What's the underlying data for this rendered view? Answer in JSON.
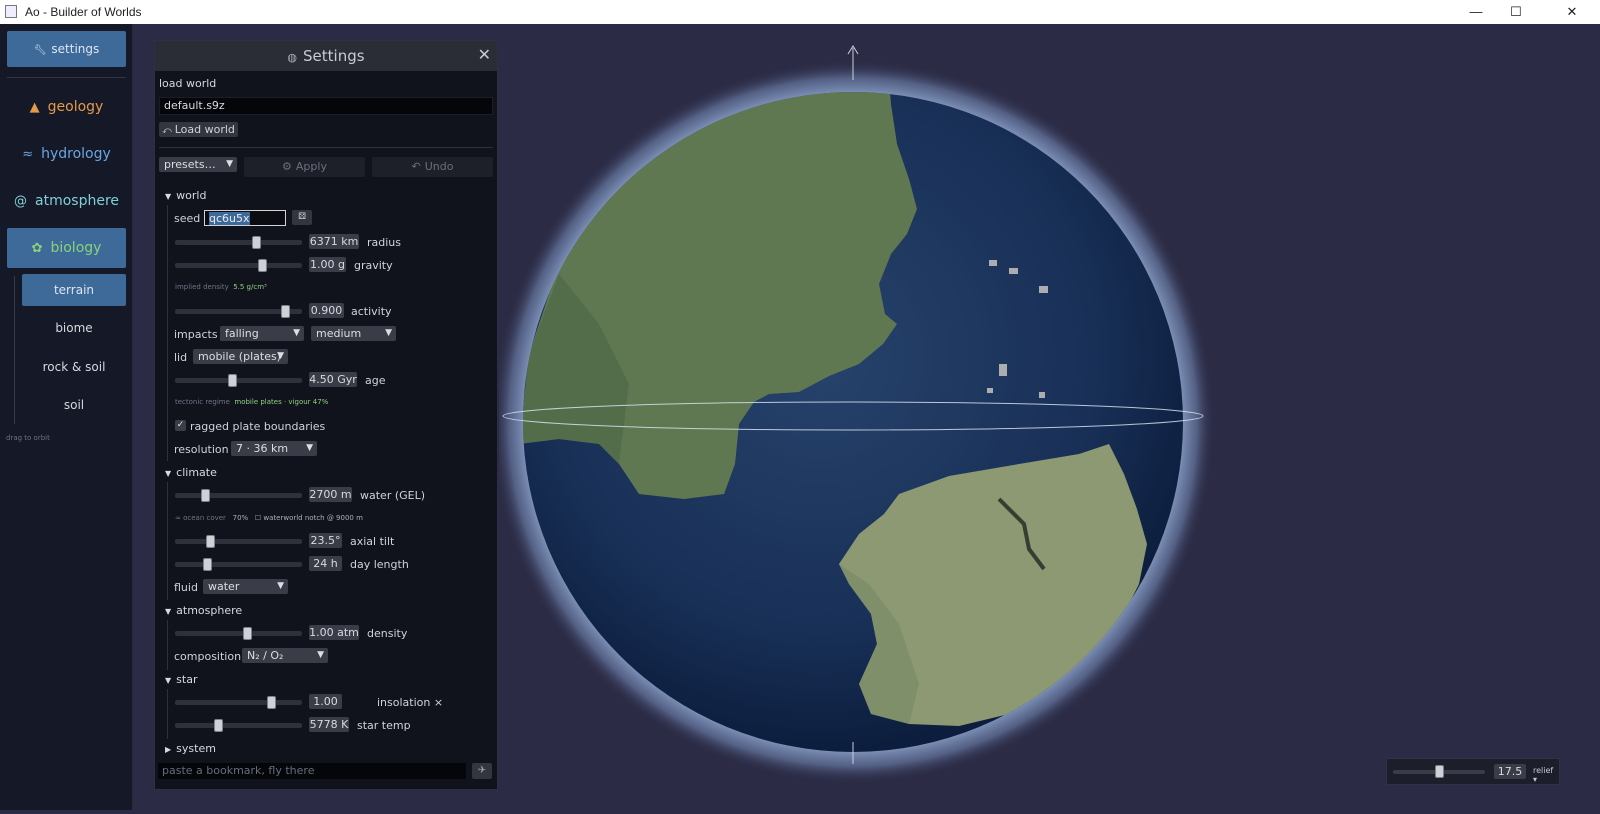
{
  "window": {
    "title": "Ao - Builder of Worlds",
    "minimize": "—",
    "maximize": "☐",
    "close": "✕"
  },
  "sidebar": {
    "settings_label": "settings",
    "categories": [
      {
        "label": "geology",
        "icon": "volcano-icon",
        "color": "#e39a4a"
      },
      {
        "label": "hydrology",
        "icon": "wave-icon",
        "color": "#6aa6e0"
      },
      {
        "label": "atmosphere",
        "icon": "swirl-icon",
        "color": "#7fd0d8"
      },
      {
        "label": "biology",
        "icon": "leaf-icon",
        "color": "#8ad27a"
      }
    ],
    "sub_items": [
      "terrain",
      "biome",
      "rock & soil",
      "soil"
    ],
    "hint": "drag to orbit"
  },
  "panel": {
    "title": "Settings",
    "load_world_heading": "load world",
    "load_world_file": "default.s9z",
    "load_world_button": "Load world",
    "presets": "presets…",
    "apply": "Apply",
    "undo": "Undo",
    "world": {
      "heading": "world",
      "seed_label": "seed",
      "seed_value": "qc6u5x",
      "radius_value": "6371 km",
      "radius_label": "radius",
      "radius_pos": 0.65,
      "gravity_value": "1.00 g",
      "gravity_label": "gravity",
      "gravity_pos": 0.7,
      "implied_density_label": "implied density",
      "implied_density_value": "5.5 g/cm³",
      "activity_value": "0.900",
      "activity_label": "activity",
      "activity_pos": 0.9,
      "impacts_label": "impacts",
      "impacts_mode": "falling",
      "impacts_level": "medium",
      "lid_label": "lid",
      "lid_value": "mobile (plates)",
      "age_value": "4.50 Gyr",
      "age_label": "age",
      "age_pos": 0.45,
      "regime_label": "tectonic regime",
      "regime_value": "mobile plates · vigour 47%",
      "ragged_label": "ragged plate boundaries",
      "resolution_label": "resolution",
      "resolution_value": "7 · 36 km"
    },
    "climate": {
      "heading": "climate",
      "water_value": "2700 m",
      "water_label": "water (GEL)",
      "water_pos": 0.22,
      "ocean_cover_label": "≈ ocean cover",
      "ocean_cover_value": "70%",
      "waterworld_note": "waterworld notch @ 9000 m",
      "tilt_value": "23.5°",
      "tilt_label": "axial tilt",
      "tilt_pos": 0.26,
      "day_value": "24 h",
      "day_label": "day length",
      "day_pos": 0.24,
      "fluid_label": "fluid",
      "fluid_value": "water"
    },
    "atmosphere": {
      "heading": "atmosphere",
      "density_value": "1.00 atm",
      "density_label": "density",
      "density_pos": 0.58,
      "composition_label": "composition",
      "composition_value": "N₂ / O₂"
    },
    "star": {
      "heading": "star",
      "insolation_value": "1.00",
      "insolation_label": "insolation ×",
      "insolation_pos": 0.78,
      "temp_value": "5778 K",
      "temp_label": "star temp",
      "temp_pos": 0.33
    },
    "system": {
      "heading": "system"
    },
    "bookmark_placeholder": "paste a bookmark, fly there"
  },
  "viewport": {
    "zoom_value": "17.5",
    "zoom_pos": 0.5,
    "relief_label": "relief ▾"
  },
  "colors": {
    "accent": "#3d6a99",
    "panel_bg": "#10121c",
    "space_bg": "#2b2b45",
    "ocean": "#1d3a66",
    "land": "#7e9c6a"
  }
}
